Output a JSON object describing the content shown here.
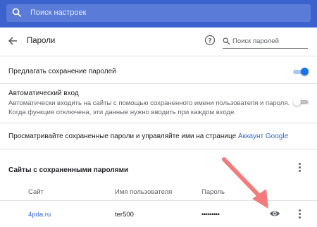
{
  "top_search": {
    "placeholder": "Поиск настроек"
  },
  "header": {
    "title": "Пароли",
    "search_placeholder": "Поиск паролей"
  },
  "offer_save": {
    "label": "Предлагать сохранение паролей",
    "enabled": true
  },
  "auto_signin": {
    "label": "Автоматический вход",
    "description_line1": "Автоматически входить на сайты с помощью сохраненного имени пользователя и пароля.",
    "description_line2": "Когда функция отключена, эти данные нужно вводить при каждом входе.",
    "enabled": false
  },
  "manage": {
    "text": "Просматривайте сохраненные пароли и управляйте ими на странице ",
    "link_text": "Аккаунт Google"
  },
  "saved_passwords": {
    "title": "Сайты с сохраненными паролями",
    "columns": {
      "site": "Сайт",
      "username": "Имя пользователя",
      "password": "Пароль"
    },
    "rows": [
      {
        "site": "4pda.ru",
        "username": "ter500",
        "password": "•••••••••"
      }
    ]
  },
  "colors": {
    "topbar": "#3c62cd",
    "accent": "#1a73e8",
    "link": "#3367d6",
    "annotation_arrow": "#f47b7b"
  },
  "icons": [
    "search-icon",
    "back-arrow-icon",
    "help-icon",
    "search-icon",
    "more-vert-icon",
    "eye-icon",
    "annotation-arrow"
  ]
}
